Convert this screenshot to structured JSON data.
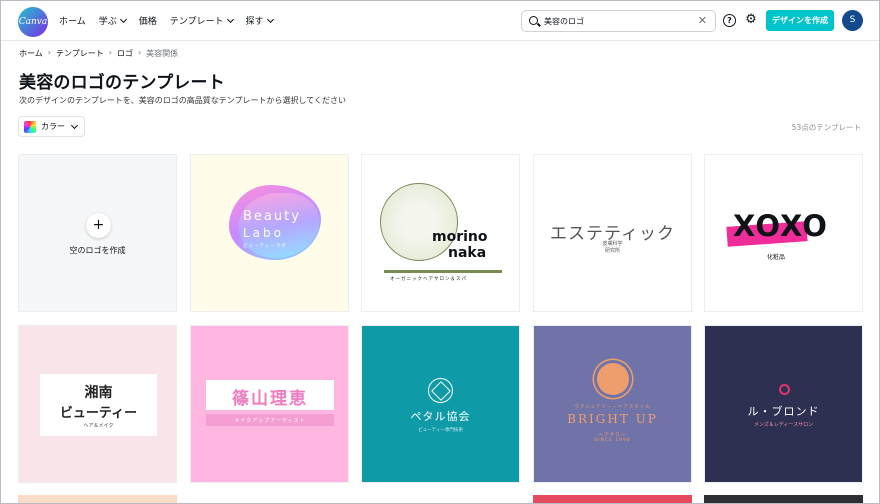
{
  "header": {
    "logo_text": "Canva",
    "nav": [
      {
        "label": "ホーム",
        "has_menu": false
      },
      {
        "label": "学ぶ",
        "has_menu": true
      },
      {
        "label": "価格",
        "has_menu": false
      },
      {
        "label": "テンプレート",
        "has_menu": true
      },
      {
        "label": "探す",
        "has_menu": true
      }
    ],
    "search_value": "美容のロゴ",
    "create_button": "デザインを作成",
    "avatar_initial": "S"
  },
  "breadcrumb": [
    "ホーム",
    "テンプレート",
    "ロゴ",
    "美容関係"
  ],
  "page": {
    "title": "美容のロゴのテンプレート",
    "subtitle": "次のデザインのテンプレートを、美容のロゴの高品質なテンプレートから選択してください",
    "color_filter": "カラー",
    "count": "53点のテンプレート"
  },
  "templates": {
    "empty_label": "空のロゴを作成",
    "t2": {
      "line1": "Beauty",
      "line2": "Labo",
      "line3": "ビューティーラボ"
    },
    "t3": {
      "line1": "morino",
      "line2": "naka",
      "line3": "オーガニックヘアサロン＆スパ"
    },
    "t4": {
      "line1": "エステティック",
      "line2": "皮膚科学",
      "line3": "研究所"
    },
    "t5": {
      "line1": "XOXO",
      "line2": "化粧品"
    },
    "t6": {
      "line1": "湘南",
      "line2": "ビューティー",
      "line3": "ヘア＆メイク"
    },
    "t7": {
      "line1": "篠山理恵",
      "line2": "メイクアップアーティスト"
    },
    "t8": {
      "line1": "ペタル協会",
      "line2": "ビューティー専門技術"
    },
    "t9": {
      "line0": "ラグジュアリー・ヘアスタイル",
      "line1": "BRIGHT UP",
      "line2": "ヘアサロン",
      "line3": "SINCE 1998"
    },
    "t10": {
      "line1": "ル・ブロンド",
      "line2": "メンズ＆レディースサロン"
    }
  },
  "colors": {
    "accent": "#00c4cc",
    "avatar": "#134a8e"
  }
}
